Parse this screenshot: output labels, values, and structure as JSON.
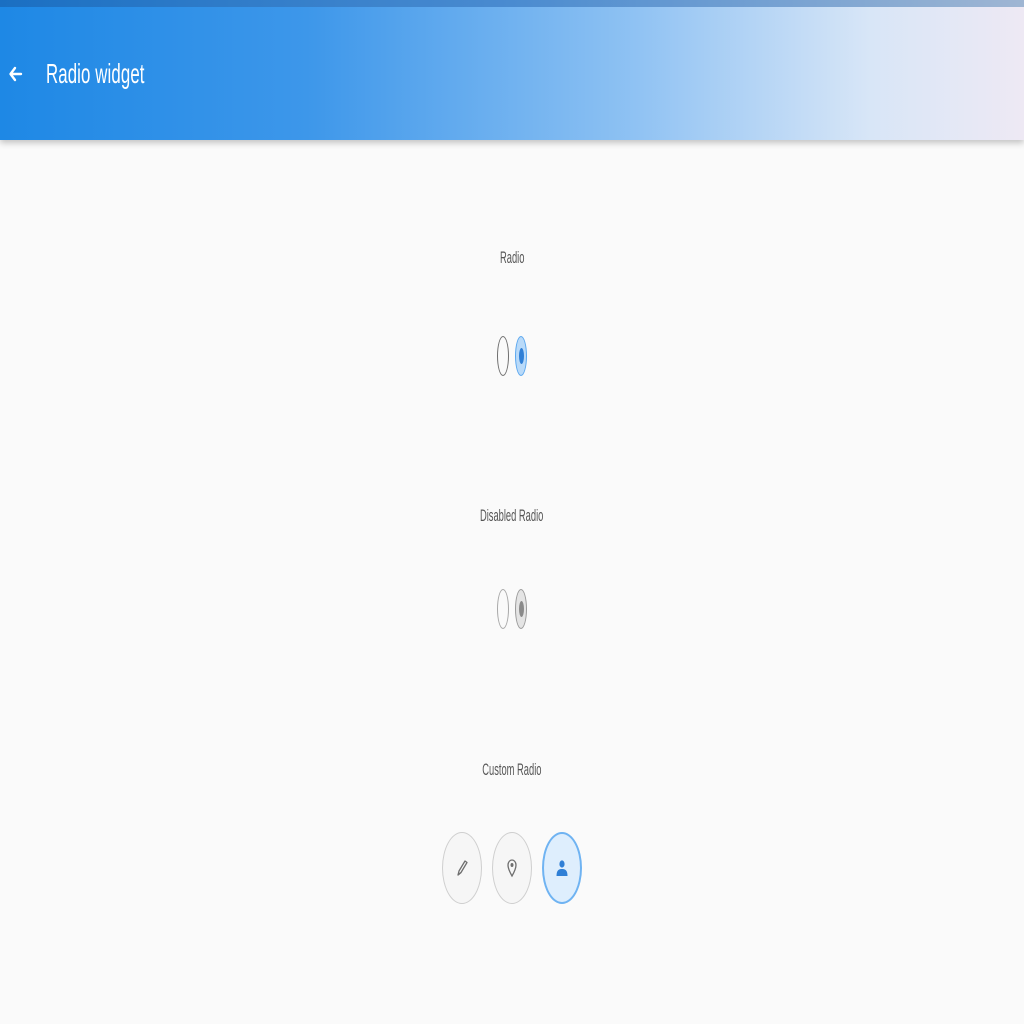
{
  "appbar": {
    "title": "Radio widget",
    "back_icon": "arrow-left-icon"
  },
  "radio_section": {
    "label": "Radio",
    "options": [
      {
        "selected": false
      },
      {
        "selected": true
      }
    ]
  },
  "disabled_section": {
    "label": "Disabled Radio",
    "options": [
      {
        "selected": false
      },
      {
        "selected": true
      }
    ]
  },
  "custom_section": {
    "label": "Custom Radio",
    "options": [
      {
        "icon": "pencil-icon",
        "selected": false
      },
      {
        "icon": "pin-icon",
        "selected": false
      },
      {
        "icon": "person-icon",
        "selected": true
      }
    ]
  },
  "colors": {
    "appbar_start": "#1e88e5",
    "accent": "#2f7fd6",
    "background": "#fafafa"
  }
}
